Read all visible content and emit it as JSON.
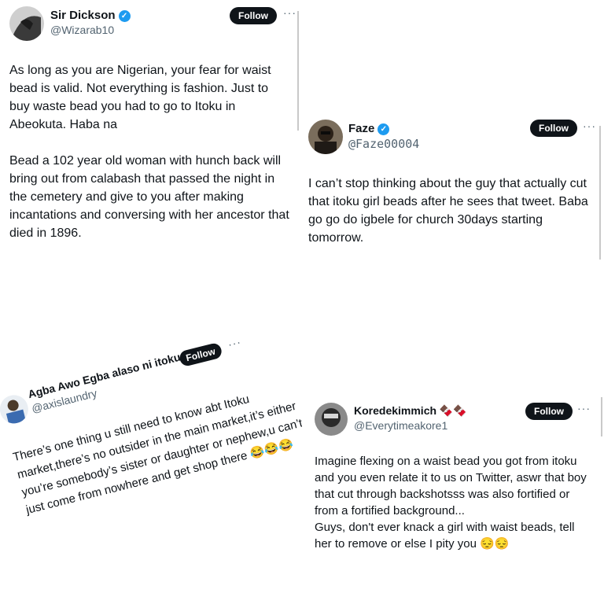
{
  "tweets": [
    {
      "name": "Sir Dickson",
      "handle": "@Wizarab10",
      "follow_label": "Follow",
      "more_icon": "more-icon",
      "verified": true,
      "text": "As long as you are Nigerian, your fear for waist bead is valid. Not everything is fashion. Just to buy waste bead you had to go to Itoku in Abeokuta. Haba na\n\nBead a 102 year old woman with hunch back will bring out from calabash that passed the night in the cemetery and give to you after making incantations and conversing with her ancestor that died in 1896."
    },
    {
      "name": "Faze",
      "handle": "@Faze00004",
      "follow_label": "Follow",
      "more_icon": "more-icon",
      "verified": true,
      "text": "I can’t stop thinking about the guy that actually cut that itoku girl beads after he sees that tweet. Baba go go do igbele for church 30days starting tomorrow."
    },
    {
      "name": "Agba Awo Egba alaso ni itoku",
      "handle": "@axislaundry",
      "follow_label": "Follow",
      "more_icon": "more-icon",
      "verified": false,
      "text": "There’s one thing u still need to know abt Itoku market,there’s no outsider in the main market,it’s either you’re somebody’s sister or daughter or nephew,u can’t just come from nowhere and get shop there 😂😂😂"
    },
    {
      "name": "Koredekimmich 🍫🍫",
      "handle": "@Everytimeakore1",
      "follow_label": "Follow",
      "more_icon": "more-icon",
      "verified": false,
      "text": "Imagine flexing on a waist bead you got from itoku and you even relate it to us on Twitter, aswr that boy that cut through backshotsss was also fortified or from a fortified background...\nGuys, don't ever knack a girl with waist beads, tell her to remove or else I pity you 😔😔"
    }
  ],
  "colors": {
    "text": "#0f1419",
    "secondary": "#536471",
    "verified": "#1d9bf0",
    "follow_bg": "#0f1419"
  }
}
